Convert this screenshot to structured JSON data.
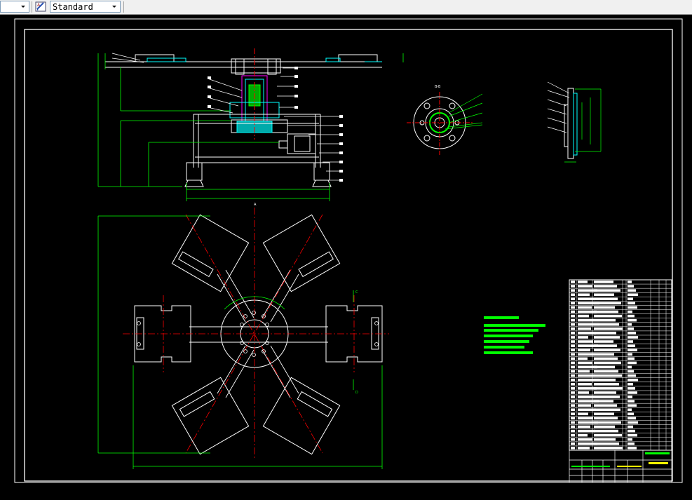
{
  "toolbar": {
    "layer_dropdown_value": "",
    "textstyle_icon": "text-style-icon",
    "textstyle_dropdown_value": "Standard",
    "dropdown_arrow_icon": "chevron-down-icon"
  },
  "drawing": {
    "background": "#000000",
    "line_colors": {
      "outline": "#ffffff",
      "dimension": "#00ff00",
      "centerline": "#ff0000",
      "hidden": "#00ffff",
      "text": "#ffffff"
    },
    "section_labels": [
      "A-A",
      "B-B",
      "C",
      "D"
    ],
    "view_marker": "A"
  }
}
